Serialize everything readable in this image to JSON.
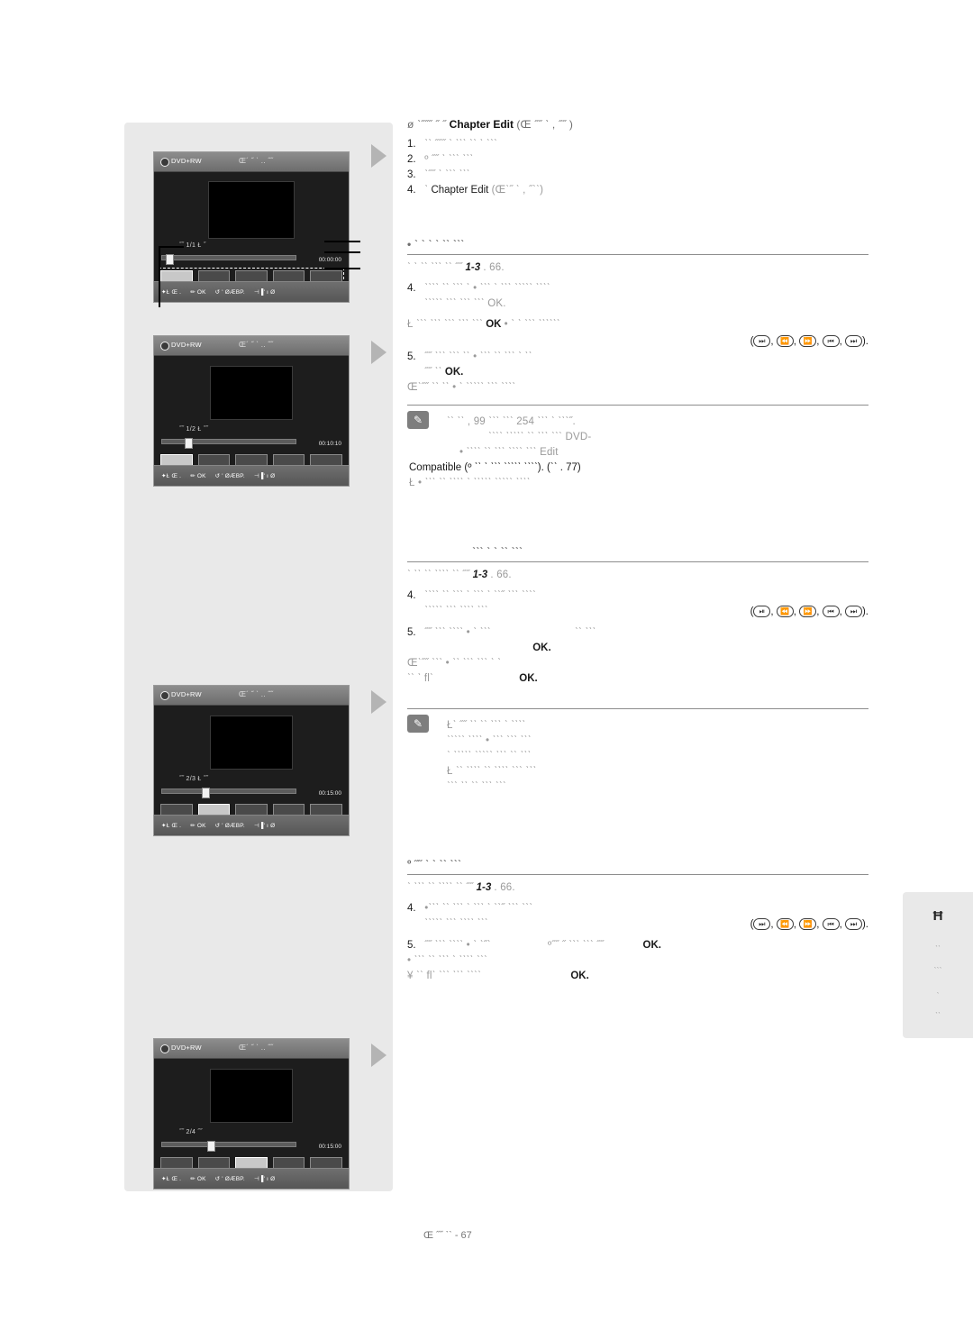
{
  "document": {
    "page_footer": "Œ  ˝˝ ˋˋ - 67"
  },
  "left_panel": {
    "screens": [
      {
        "disc_type": "DVD+RW",
        "title_label": "Œ´ ˝ ˋ .. ˝˝",
        "ol_label": "˝˝ 1/1 Ł ˝",
        "timecode": "00:00:00",
        "knob_left_pct": 3,
        "thumbs": [
          "sel",
          "dark",
          "dark",
          "dark",
          "dark"
        ],
        "dashed": true,
        "bottombar": [
          "✦Ł Œ .",
          "✏ OK",
          "↺ ' ØÆBP.",
          "⊣▐' ı  Ø"
        ]
      },
      {
        "disc_type": "DVD+RW",
        "title_label": "Œ´ ˝ ˋ .. ˝˝",
        "ol_label": "˝˝ 1/2 Ł ˝˝",
        "timecode": "00:10:10",
        "knob_left_pct": 17,
        "thumbs": [
          "sel",
          "dark",
          "dark",
          "dark",
          "dark"
        ],
        "dashed": false,
        "bottombar": [
          "✦Ł Œ .",
          "✏ OK",
          "↺ ' ØÆBP.",
          "⊣▐' ı  Ø"
        ]
      },
      {
        "disc_type": "DVD+RW",
        "title_label": "Œ´ ˝ ˋ .. ˝˝",
        "ol_label": "˝˝ 2/3 Ł ˝˝",
        "timecode": "00:15:00",
        "knob_left_pct": 30,
        "thumbs": [
          "dark",
          "sel",
          "dark",
          "dark",
          "dark"
        ],
        "dashed": false,
        "bottombar": [
          "✦Ł Œ .",
          "✏ OK",
          "↺ ' ØÆBP.",
          "⊣▐' ı  Ø"
        ]
      },
      {
        "disc_type": "DVD+RW",
        "title_label": "Œ´ ˝ ˋ .. ˝˝",
        "ol_label": "˝˝ 2/4 ˝˝",
        "timecode": "00:15:00",
        "knob_left_pct": 34,
        "thumbs": [
          "dark",
          "dark",
          "sel",
          "dark",
          "dark"
        ],
        "dashed": false,
        "bottombar": [
          "✦Ł Œ .",
          "✏ OK",
          "↺ ' ØÆBP.",
          "⊣▐' ı  Ø"
        ]
      }
    ]
  },
  "section1": {
    "heading_pre": "ø ˋ˝˝˝   ˝   ˝",
    "heading_bold": "Chapter Edit",
    "heading_post": "(Œ ˝˝ ˋ ,   ˝˝ )",
    "steps": [
      {
        "num": "1.",
        "text": "ˋˋ ˝˝˝ ˋ ˋˋˋ ˋˋ ˋ   ˋˋˋ"
      },
      {
        "num": "2.",
        "text": "º ˝˝   ˋ ˋˋˋ  ˋˋˋ"
      },
      {
        "num": "3.",
        "text": "ˋ˝˝   ˋ ˋˋˋ  ˋˋˋ"
      },
      {
        "num": "4.",
        "text": "ˋ",
        "bold": "Chapter Edit",
        "after": "(Œˋ˝ ˋ ,  ˝ˋˋ)"
      }
    ]
  },
  "section2": {
    "bullet_title": "•    ˋ   ˋ  ˋ   ˋ ˋˋ ˋˋˋ",
    "ref_line_pre": "ˋ    ˋ ˋˋ    ˋˋˋ ˋˋ ˝˝",
    "ref_line_bold": "1-3",
    "ref_line_post": ".  66.",
    "steps": [
      {
        "num": "4.",
        "lines": [
          "ˋˋˋˋ  ˋˋ ˋˋˋ ˋ • ˋˋˋ ˋ ˋˋˋ ˋˋˋˋˋ ˋˋˋˋ",
          "ˋˋˋˋˋ ˋˋˋ ˋˋˋ  ˋˋˋ   OK."
        ]
      }
    ],
    "ok_note_pre": "Ł ˋˋˋ ˋˋˋ ˋˋˋ ˋˋˋ  ˋˋˋ",
    "ok_note_bold": "OK",
    "ok_note_post": "• ˋ ˋ ˋˋˋ  ˋˋˋˋˋˋ",
    "keys_row1": [
      "⏭",
      "⏪",
      "⏩",
      "⏮",
      "⏭"
    ],
    "step5": {
      "num": "5.",
      "line1": "˝˝ ˋˋˋ ˋˋˋ ˋˋ •   ˋˋˋ        ˋˋ ˋˋˋ ˋ  ˋˋ",
      "line2_pre": "˝˝ ˋˋ",
      "line2_bold": "OK.",
      "line3": "Œˋ˝˝ ˋˋ ˋˋ • ˋ ˋˋˋˋˋ ˋˋˋ ˋˋˋˋ"
    },
    "note": {
      "icon": "✎",
      "lines": [
        "ˋˋ   ˋˋ , 99 ˋˋˋ ˋˋˋ 254 ˋˋˋ ˋ ˋˋˋ˝.",
        "ˋˋˋˋ ˋˋˋˋˋ ˋˋ ˋˋˋ ˋˋˋ DVD-",
        "• ˋˋˋˋ ˋˋ ˋˋˋ ˋˋˋˋ ˋˋˋ Edit",
        "Compatible (º ˋˋ ˋ ˋˋˋ ˋˋˋˋˋ ˋˋˋˋ). (ˋˋ . 77)",
        "Ł • ˋˋˋ ˋˋ ˋˋˋˋ ˋ ˋˋˋˋˋ ˋˋˋˋˋ ˋˋˋˋ"
      ]
    }
  },
  "section3": {
    "title": "ˋˋˋ   ˋ   ˋ  ˋˋ ˋˋˋ",
    "ref_line_pre": "ˋ   ˋˋ ˋˋ  ˋˋˋˋ ˋˋ ˝˝",
    "ref_line_bold": "1-3",
    "ref_line_post": ".  66.",
    "step4": {
      "num": "4.",
      "lines": [
        "ˋˋˋˋ ˋˋ ˋˋˋ ˋ ˋˋˋ ˋ ˋˋ˝ ˋˋˋ ˋˋˋˋ",
        "ˋˋˋˋˋ ˋˋˋ ˋˋˋˋ ˋˋˋ"
      ]
    },
    "keys_row": [
      "⏯",
      "⏪",
      "⏩",
      "⏮",
      "⏭"
    ],
    "step5": {
      "num": "5.",
      "line1_pre": "˝˝ ˋˋˋ ˋˋˋˋ • ˋ ˋˋˋ",
      "line1_post": "ˋˋ ˋˋˋ",
      "line2_bold": "OK.",
      "line3_pre": "Œˋ˝˝ ˋˋˋ  • ˋˋ ˋˋˋ  ˋˋˋ ˋ ˋ",
      "line4_pre": "ˋˋ ˋ flˋ",
      "line4_bold": "OK."
    },
    "note": {
      "icon": "✎",
      "lines": [
        "Łˋ ˝˝ ˋˋ ˋˋ ˋˋˋ ˋ ˋˋˋˋ",
        "ˋˋˋˋˋ ˋˋˋˋ • ˋˋˋ ˋˋˋ ˋˋˋ",
        "ˋ ˋˋˋˋˋ ˋˋˋˋˋ ˋˋˋ ˋˋ ˋˋˋ",
        "Ł ˋˋ ˋˋˋˋ ˋˋ ˋˋˋˋ ˋˋˋ ˋˋˋ",
        "ˋˋˋ ˋˋ ˋˋ ˋˋˋ ˋˋˋ"
      ]
    }
  },
  "section4": {
    "title": "º ˝˝   ˋ    ˋ  ˋˋ ˋˋˋ",
    "ref_line_pre": "ˋ   ˋˋˋ ˋˋ ˋˋˋˋ ˋˋ ˝˝",
    "ref_line_bold": "1-3",
    "ref_line_post": ".  66.",
    "step4": {
      "num": "4.",
      "lines": [
        "•ˋˋˋ ˋˋ ˋˋˋ ˋ ˋˋˋ ˋ ˋˋ˝ ˋˋˋ ˋˋˋ",
        "ˋˋˋˋˋ ˋˋˋ ˋˋˋˋ ˋˋˋ"
      ]
    },
    "keys_row": [
      "⏭",
      "⏪",
      "⏩",
      "⏮",
      "⏭"
    ],
    "step5": {
      "num": "5.",
      "line1_a": "˝˝ ˋˋˋ ˋˋˋˋ • ˋ ˋ˝ˋ",
      "line1_b": "º˝˝ ˝ ˋˋˋ ˋˋˋ ˝˝",
      "line1_ok": "OK.",
      "line2": "• ˋˋˋ ˋˋ ˋˋˋ ˋ ˋˋˋˋ ˋˋˋ",
      "line3_pre": "¥ ˋˋ flˋ ˋˋˋ ˋˋˋ ˋˋˋˋ",
      "line3_ok": "OK."
    }
  },
  "side_tab": {
    "letter": "Ħ",
    "lines": [
      "ˋˋ",
      "ˋˋˋ",
      "ˋ",
      "ˋˋ"
    ]
  }
}
